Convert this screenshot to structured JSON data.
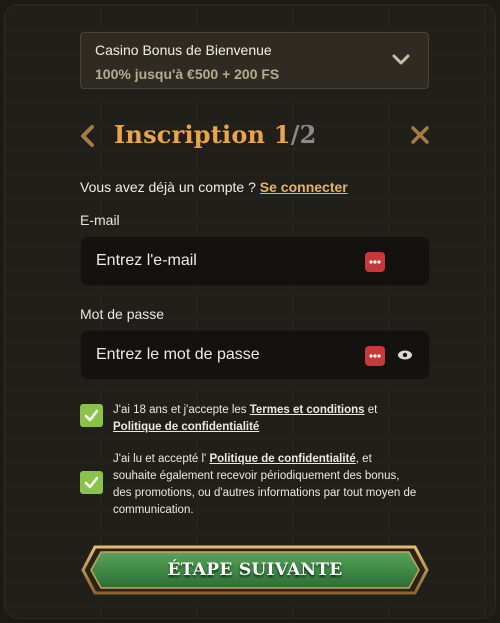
{
  "bonus": {
    "title": "Casino Bonus de Bienvenue",
    "subtitle": "100% jusqu'à €500 + 200 FS",
    "icon": "chevron-down-icon"
  },
  "header": {
    "title": "Inscription",
    "step_current": "1",
    "step_separator": "/",
    "step_total": "2"
  },
  "login": {
    "prompt": "Vous avez déjà un compte ?",
    "link": "Se connecter"
  },
  "email": {
    "label": "E-mail",
    "placeholder": "Entrez l'e-mail",
    "value": ""
  },
  "password": {
    "label": "Mot de passe",
    "placeholder": "Entrez le mot de passe",
    "value": ""
  },
  "consent1": {
    "text_before": "J'ai 18 ans et j'accepte les ",
    "terms_link": "Termes et conditions",
    "text_middle": " et ",
    "privacy_link": "Politique de confidentialité",
    "checked": true
  },
  "consent2": {
    "text_before": "J'ai lu et accepté l' ",
    "privacy_link": "Politique de confidentialité",
    "text_after": ", et souhaite également recevoir périodiquement des bonus, des promotions, ou d'autres informations par tout moyen de communication.",
    "checked": true
  },
  "cta": {
    "label": "ÉTAPE SUIVANTE"
  },
  "colors": {
    "accent": "#e8a54a",
    "check": "#8bc34a",
    "cta": "#3f8a45",
    "keypass": "#c8383b"
  }
}
